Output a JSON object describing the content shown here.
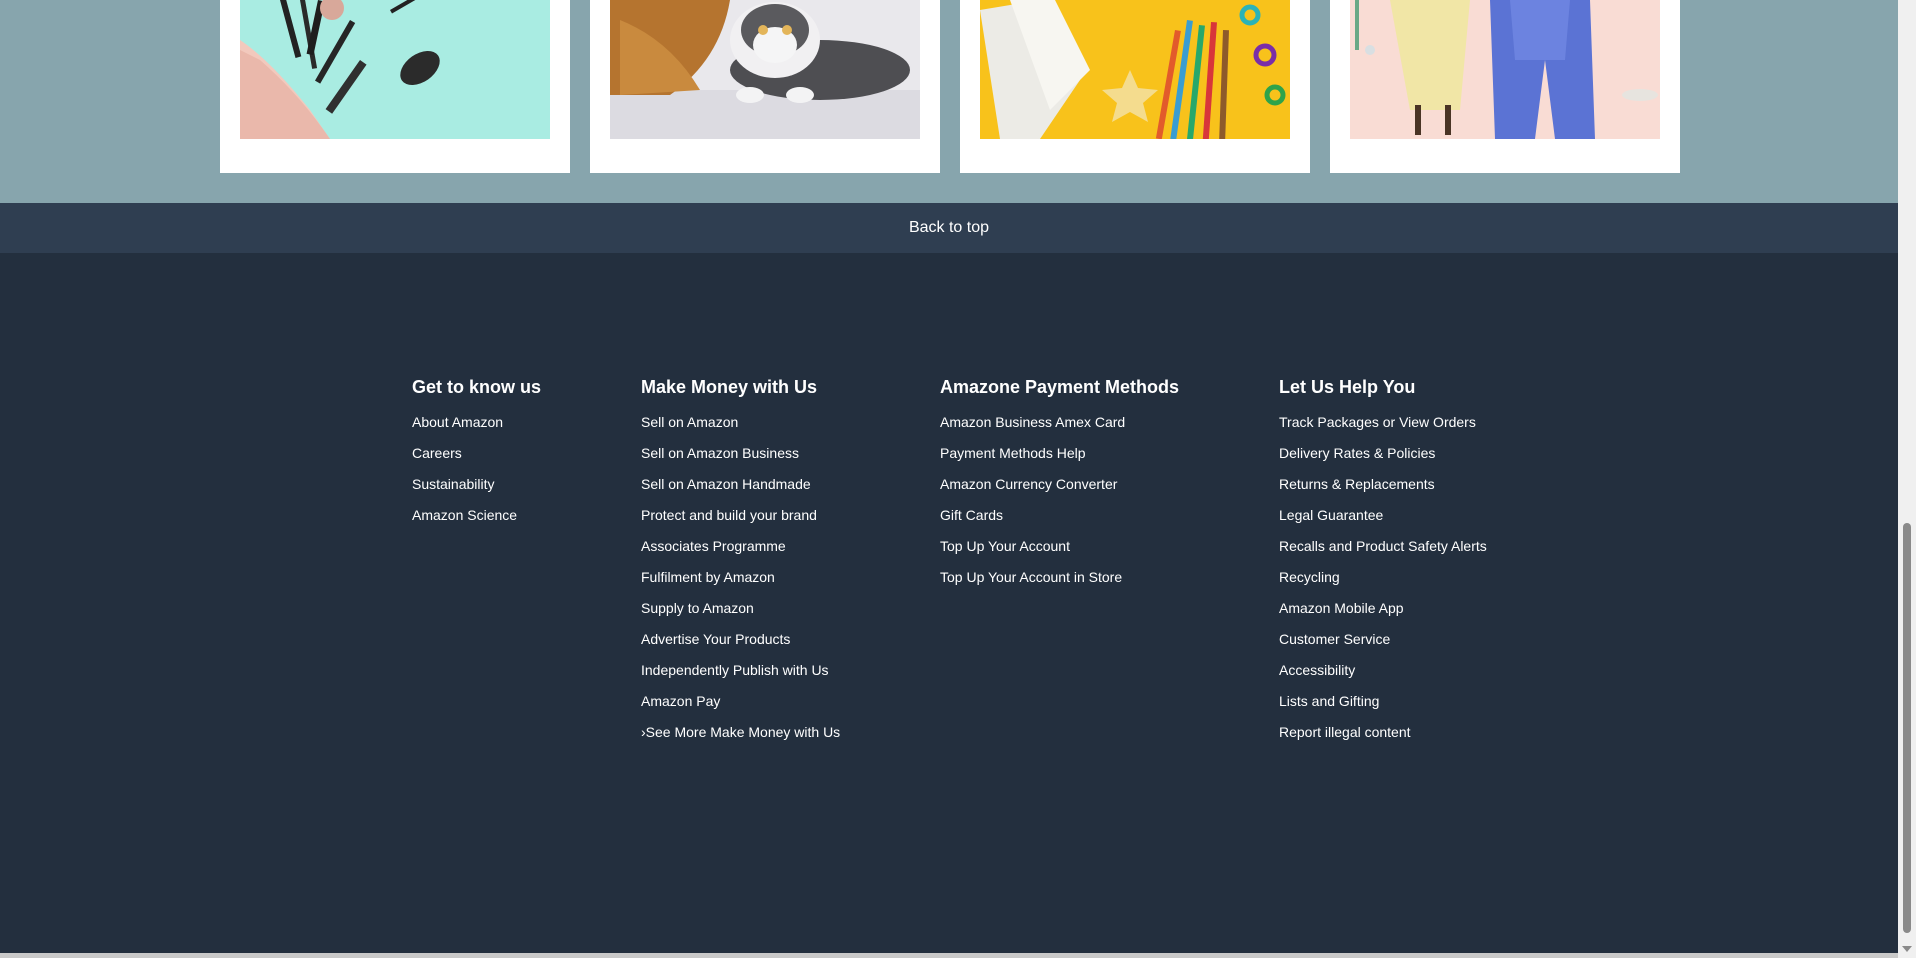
{
  "back_to_top": {
    "label": "Back to top"
  },
  "cards": [
    {
      "icon": "makeup-brushes-image"
    },
    {
      "icon": "cats-image"
    },
    {
      "icon": "toys-and-pencils-image"
    },
    {
      "icon": "fashion-outfits-image"
    }
  ],
  "footer": {
    "columns": [
      {
        "heading": "Get to know us",
        "links": [
          "About Amazon",
          "Careers",
          "Sustainability",
          "Amazon Science"
        ]
      },
      {
        "heading": "Make Money with Us",
        "links": [
          "Sell on Amazon",
          "Sell on Amazon Business",
          "Sell on Amazon Handmade",
          "Protect and build your brand",
          "Associates Programme",
          "Fulfilment by Amazon",
          "Supply to Amazon",
          "Advertise Your Products",
          "Independently Publish with Us",
          "Amazon Pay",
          "›See More Make Money with Us"
        ]
      },
      {
        "heading": "Amazone Payment Methods",
        "links": [
          "Amazon Business Amex Card",
          "Payment Methods Help",
          "Amazon Currency Converter",
          "Gift Cards",
          "Top Up Your Account",
          "Top Up Your Account in Store"
        ]
      },
      {
        "heading": "Let Us Help You",
        "links": [
          "Track Packages or View Orders",
          "Delivery Rates & Policies",
          "Returns & Replacements",
          "Legal Guarantee",
          "Recalls and Product Safety Alerts",
          "Recycling",
          "Amazon Mobile App",
          "Customer Service",
          "Accessibility",
          "Lists and Gifting",
          "Report illegal content"
        ]
      }
    ]
  },
  "colors": {
    "footer_bg": "#232f3e",
    "back_to_top_bg": "#2f3e51",
    "cards_strip_bg": "#87a5ad"
  }
}
